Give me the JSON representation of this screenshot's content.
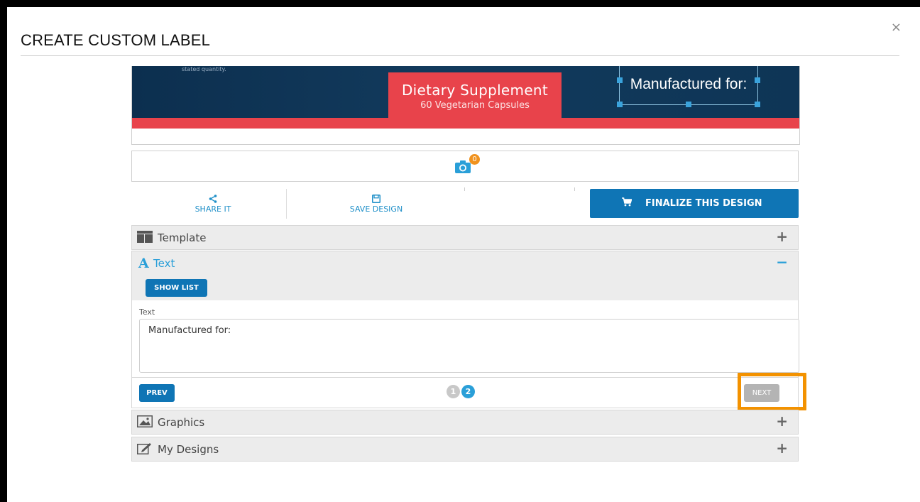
{
  "modal": {
    "title": "CREATE CUSTOM LABEL",
    "close": "×"
  },
  "preview": {
    "small_text": "stated quantity.",
    "supplement_title": "Dietary Supplement",
    "supplement_subtitle": "60 Vegetarian Capsules",
    "selected_text": "Manufactured for:",
    "photo_badge": "0"
  },
  "toolbar": {
    "share_label": "SHARE IT",
    "save_label": "SAVE DESIGN",
    "finalize_label": "FINALIZE THIS DESIGN"
  },
  "accordion": {
    "template": {
      "label": "Template",
      "toggle": "+"
    },
    "text": {
      "label": "Text",
      "toggle": "−"
    },
    "graphics": {
      "label": "Graphics",
      "toggle": "+"
    },
    "my_designs": {
      "label": "My Designs",
      "toggle": "+"
    }
  },
  "text_panel": {
    "show_list": "SHOW LIST",
    "field_label": "Text",
    "field_value": "Manufactured for:"
  },
  "pager": {
    "prev": "PREV",
    "next": "NEXT",
    "pages": [
      "1",
      "2"
    ],
    "current_page": "2"
  },
  "colors": {
    "accent_blue": "#0f75b5",
    "link_blue": "#2a9fd8",
    "label_navy": "#0e3556",
    "label_red": "#e8434b",
    "highlight_orange": "#f39200",
    "badge_orange": "#f0921e"
  }
}
